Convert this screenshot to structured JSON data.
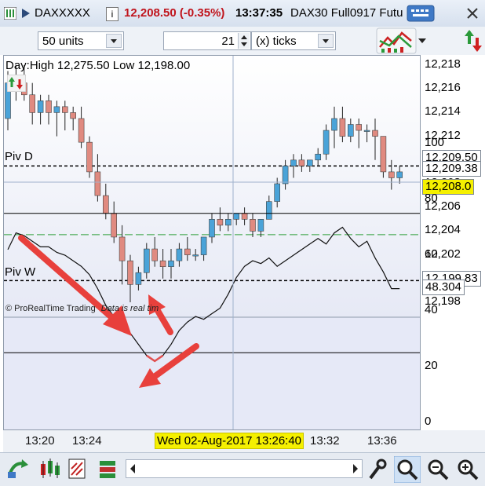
{
  "title_bar": {
    "symbol": "DAXXXXX",
    "info_glyph": "i",
    "price": "12,208.50 (-0.35%)",
    "time": "13:37:35",
    "instrument": "DAX30 Full0917 Futu",
    "icons": [
      "grid-icon",
      "info-icon",
      "keyboard-icon",
      "close-icon"
    ]
  },
  "toolbar": {
    "units_value": "50 units",
    "ticks_value": "21",
    "ticks_unit_value": "(x) ticks",
    "icons": [
      "chart-type-icon",
      "refresh-icon"
    ]
  },
  "chart": {
    "day_range": "Day:High 12,275.50 Low 12,198.00",
    "pivot_d_label": "Piv D",
    "pivot_w_label": "Piv W",
    "watermark": "© ProRealTime Trading",
    "data_note": "Data is real tim",
    "price_tick_labels": [
      "12,218",
      "12,216",
      "12,214",
      "12,212",
      "12,210",
      "12,208",
      "12,206",
      "12,204",
      "12,202",
      "12,200",
      "12,198"
    ],
    "price_label_pivot_d": "12,209.50",
    "price_label_last": "12,209.38",
    "price_label_current": "12,208.0",
    "price_label_pivot_w": "12,199.83",
    "indicator_tick_labels": [
      "100",
      "80",
      "60",
      "40",
      "20",
      "0"
    ],
    "indicator_value": "48.304",
    "time_labels": [
      "13:20",
      "13:24",
      "13:32",
      "13:36"
    ],
    "crosshair_time": "Wed 02-Aug-2017 13:26:40",
    "colors": {
      "up": "#4aa3d8",
      "down": "#e08a80",
      "pivot": "#000000",
      "green_line": "#2e9e3a",
      "crosshair_box": "#f5f000"
    }
  },
  "chart_data": {
    "type": "candlestick",
    "title": "DAX30 Full0917",
    "levels": {
      "pivot_d": 12209.5,
      "pivot_w": 12199.83,
      "last": 12209.38,
      "current": 12208.0
    },
    "ylim": [
      12197,
      12219
    ],
    "candles": [
      {
        "o": 12213.5,
        "h": 12217.5,
        "l": 12212.5,
        "c": 12216.5
      },
      {
        "o": 12216.0,
        "h": 12218.0,
        "l": 12215.0,
        "c": 12216.5
      },
      {
        "o": 12216.5,
        "h": 12218.0,
        "l": 12215.0,
        "c": 12215.5
      },
      {
        "o": 12215.5,
        "h": 12216.5,
        "l": 12213.0,
        "c": 12214.0
      },
      {
        "o": 12214.0,
        "h": 12215.5,
        "l": 12213.0,
        "c": 12215.0
      },
      {
        "o": 12215.0,
        "h": 12215.5,
        "l": 12213.0,
        "c": 12214.0
      },
      {
        "o": 12214.0,
        "h": 12215.0,
        "l": 12212.0,
        "c": 12214.5
      },
      {
        "o": 12214.5,
        "h": 12215.0,
        "l": 12212.5,
        "c": 12214.0
      },
      {
        "o": 12214.0,
        "h": 12214.5,
        "l": 12212.5,
        "c": 12213.5
      },
      {
        "o": 12213.5,
        "h": 12214.5,
        "l": 12211.0,
        "c": 12211.5
      },
      {
        "o": 12211.5,
        "h": 12212.0,
        "l": 12208.5,
        "c": 12209.0
      },
      {
        "o": 12209.0,
        "h": 12210.5,
        "l": 12206.5,
        "c": 12207.0
      },
      {
        "o": 12207.0,
        "h": 12208.0,
        "l": 12205.0,
        "c": 12205.5
      },
      {
        "o": 12205.5,
        "h": 12206.5,
        "l": 12203.0,
        "c": 12203.5
      },
      {
        "o": 12203.5,
        "h": 12204.5,
        "l": 12199.5,
        "c": 12201.5
      },
      {
        "o": 12201.5,
        "h": 12202.0,
        "l": 12198.0,
        "c": 12199.5
      },
      {
        "o": 12199.5,
        "h": 12201.0,
        "l": 12199.0,
        "c": 12200.5
      },
      {
        "o": 12200.5,
        "h": 12203.0,
        "l": 12200.0,
        "c": 12202.5
      },
      {
        "o": 12202.5,
        "h": 12203.5,
        "l": 12201.0,
        "c": 12201.5
      },
      {
        "o": 12201.5,
        "h": 12202.5,
        "l": 12200.0,
        "c": 12201.0
      },
      {
        "o": 12201.0,
        "h": 12202.5,
        "l": 12200.0,
        "c": 12201.5
      },
      {
        "o": 12201.5,
        "h": 12203.0,
        "l": 12201.0,
        "c": 12202.5
      },
      {
        "o": 12202.5,
        "h": 12203.5,
        "l": 12201.5,
        "c": 12202.0
      },
      {
        "o": 12202.0,
        "h": 12202.5,
        "l": 12201.5,
        "c": 12202.0
      },
      {
        "o": 12202.0,
        "h": 12203.5,
        "l": 12201.5,
        "c": 12203.5
      },
      {
        "o": 12203.5,
        "h": 12205.5,
        "l": 12203.0,
        "c": 12205.0
      },
      {
        "o": 12205.0,
        "h": 12206.0,
        "l": 12204.0,
        "c": 12204.5
      },
      {
        "o": 12204.5,
        "h": 12205.5,
        "l": 12204.0,
        "c": 12205.0
      },
      {
        "o": 12205.0,
        "h": 12205.5,
        "l": 12204.5,
        "c": 12205.5
      },
      {
        "o": 12205.5,
        "h": 12206.0,
        "l": 12204.5,
        "c": 12205.0
      },
      {
        "o": 12205.0,
        "h": 12205.5,
        "l": 12203.5,
        "c": 12204.0
      },
      {
        "o": 12204.0,
        "h": 12205.0,
        "l": 12203.5,
        "c": 12205.0
      },
      {
        "o": 12205.0,
        "h": 12207.0,
        "l": 12205.0,
        "c": 12206.5
      },
      {
        "o": 12206.5,
        "h": 12208.5,
        "l": 12206.0,
        "c": 12208.0
      },
      {
        "o": 12208.0,
        "h": 12210.0,
        "l": 12207.5,
        "c": 12209.5
      },
      {
        "o": 12209.5,
        "h": 12210.5,
        "l": 12208.5,
        "c": 12210.0
      },
      {
        "o": 12210.0,
        "h": 12210.5,
        "l": 12209.0,
        "c": 12209.5
      },
      {
        "o": 12209.5,
        "h": 12210.0,
        "l": 12209.0,
        "c": 12210.0
      },
      {
        "o": 12210.0,
        "h": 12211.0,
        "l": 12209.5,
        "c": 12210.5
      },
      {
        "o": 12210.5,
        "h": 12213.0,
        "l": 12210.0,
        "c": 12212.5
      },
      {
        "o": 12212.5,
        "h": 12214.5,
        "l": 12211.0,
        "c": 12213.5
      },
      {
        "o": 12213.5,
        "h": 12214.5,
        "l": 12211.5,
        "c": 12212.0
      },
      {
        "o": 12212.0,
        "h": 12213.5,
        "l": 12211.5,
        "c": 12213.0
      },
      {
        "o": 12213.0,
        "h": 12213.5,
        "l": 12211.0,
        "c": 12212.5
      },
      {
        "o": 12212.5,
        "h": 12213.0,
        "l": 12211.5,
        "c": 12212.5
      },
      {
        "o": 12212.5,
        "h": 12213.5,
        "l": 12210.0,
        "c": 12212.0
      },
      {
        "o": 12212.0,
        "h": 12212.0,
        "l": 12208.5,
        "c": 12209.0
      },
      {
        "o": 12209.0,
        "h": 12210.0,
        "l": 12207.5,
        "c": 12208.5
      },
      {
        "o": 12208.5,
        "h": 12209.5,
        "l": 12208.0,
        "c": 12209.0
      }
    ],
    "indicator": {
      "ylim": [
        0,
        100
      ],
      "levels": [
        75,
        25
      ],
      "values": [
        62,
        68,
        67,
        65,
        63,
        63,
        61,
        60,
        58,
        56,
        53,
        48,
        42,
        38,
        35,
        32,
        28,
        24,
        22,
        24,
        28,
        33,
        36,
        38,
        37,
        39,
        41,
        46,
        52,
        56,
        58,
        57,
        59,
        56,
        58,
        60,
        62,
        64,
        66,
        64,
        68,
        70,
        66,
        63,
        65,
        59,
        54,
        48,
        48
      ]
    }
  }
}
